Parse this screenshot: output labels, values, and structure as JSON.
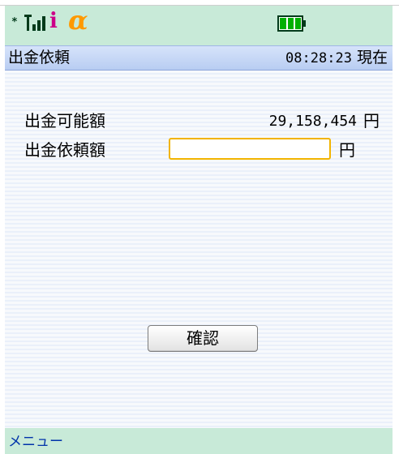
{
  "status_bar": {
    "antenna_mark": "*",
    "icons": [
      "signal-icon",
      "imode-icon",
      "alpha-icon",
      "battery-icon"
    ],
    "imode_glyph": "i",
    "alpha_glyph": "α",
    "battery_level": 1.0
  },
  "header": {
    "title": "出金依頼",
    "time": "08:28:23",
    "time_suffix": "現在"
  },
  "form": {
    "available_label": "出金可能額",
    "available_amount": "29,158,454",
    "available_unit": "円",
    "request_label": "出金依頼額",
    "request_value": "",
    "request_unit": "円"
  },
  "confirm_label": "確認",
  "softkey": {
    "menu_label": "メニュー"
  },
  "colors": {
    "status_bar_bg": "#c8ead8",
    "title_bar_bg": "#b8cdf2",
    "input_border": "#f2b400",
    "imode": "#cc0088",
    "alpha": "#ff9900",
    "battery": "#00b000",
    "softkey_text": "#0033aa"
  }
}
